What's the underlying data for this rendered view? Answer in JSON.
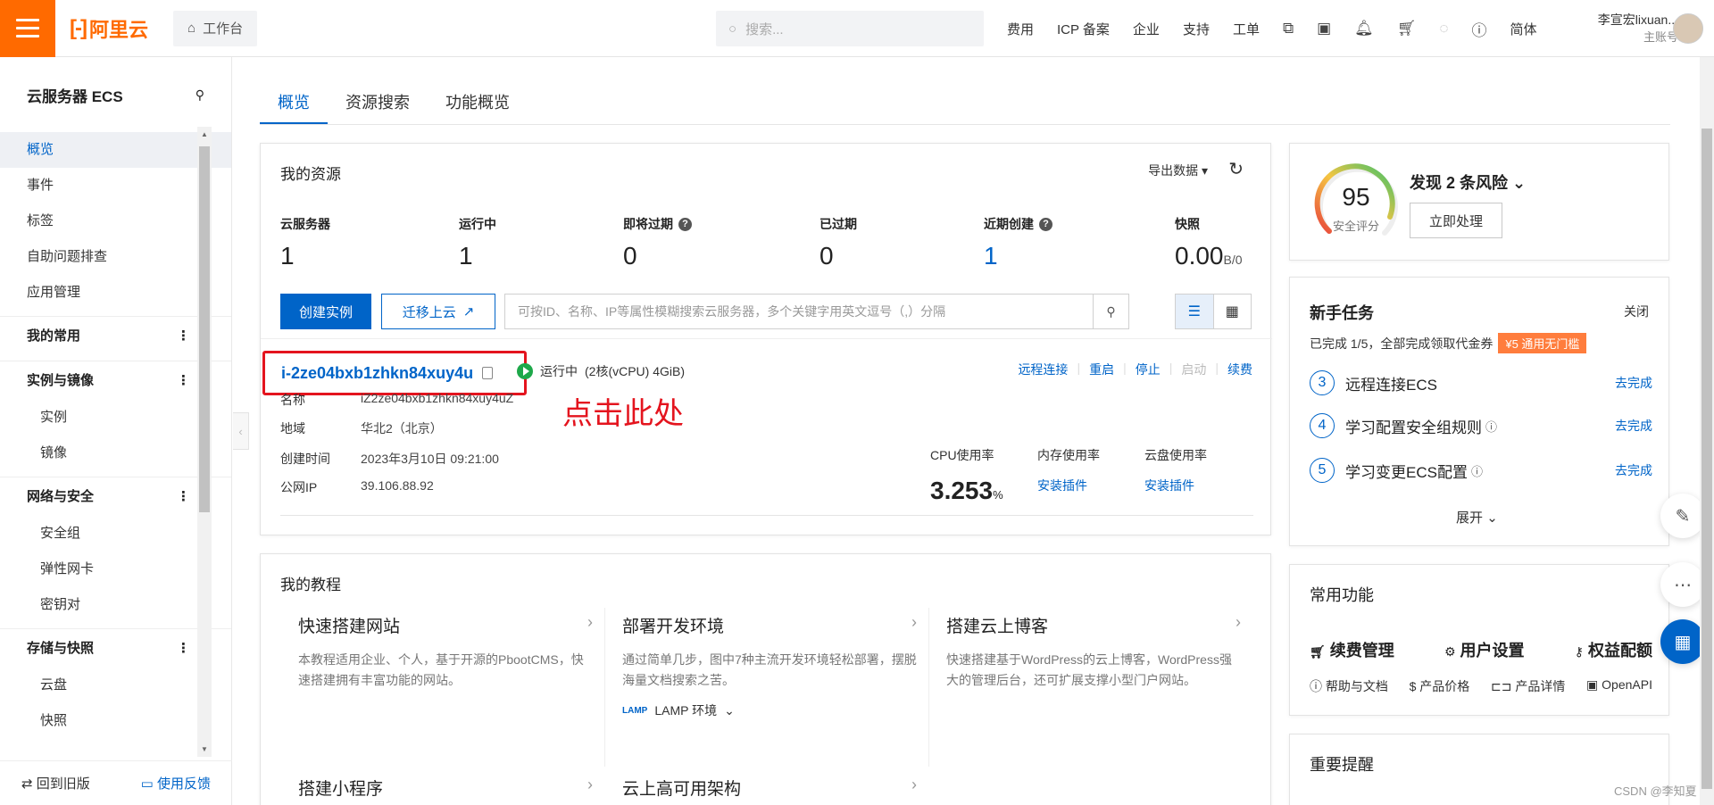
{
  "topbar": {
    "logo_text": "阿里云",
    "workbench": "工作台",
    "search_placeholder": "搜索...",
    "nav": [
      "费用",
      "ICP 备案",
      "企业",
      "支持",
      "工单"
    ],
    "lang": "简体",
    "account_name": "李宣宏lixuan...",
    "account_type": "主账号"
  },
  "sidebar": {
    "title": "云服务器 ECS",
    "items": [
      "概览",
      "事件",
      "标签",
      "自助问题排查",
      "应用管理"
    ],
    "groups": [
      {
        "name": "我的常用",
        "items": []
      },
      {
        "name": "实例与镜像",
        "items": [
          "实例",
          "镜像"
        ]
      },
      {
        "name": "网络与安全",
        "items": [
          "安全组",
          "弹性网卡",
          "密钥对"
        ]
      },
      {
        "name": "存储与快照",
        "items": [
          "云盘",
          "快照"
        ]
      }
    ],
    "footer_back": "回到旧版",
    "footer_feedback": "使用反馈"
  },
  "tabs": [
    "概览",
    "资源搜索",
    "功能概览"
  ],
  "resources": {
    "title": "我的资源",
    "export": "导出数据",
    "stats": [
      {
        "label": "云服务器",
        "value": "1"
      },
      {
        "label": "运行中",
        "value": "1"
      },
      {
        "label": "即将过期",
        "value": "0"
      },
      {
        "label": "已过期",
        "value": "0"
      },
      {
        "label": "近期创建",
        "value": "1"
      },
      {
        "label": "快照",
        "value": "0.00",
        "unit": "B/0"
      }
    ],
    "create_btn": "创建实例",
    "migrate_btn": "迁移上云",
    "search_placeholder": "可按ID、名称、IP等属性模糊搜索云服务器，多个关键字用英文逗号（,）分隔",
    "instance": {
      "id": "i-2ze04bxb1zhkn84xuy4u",
      "status": "运行中",
      "spec": "(2核(vCPU) 4GiB)",
      "annotation": "点击此处",
      "actions": [
        "远程连接",
        "重启",
        "停止",
        "启动",
        "续费"
      ],
      "fields": [
        {
          "k": "名称",
          "v": "iZ2ze04bxb1zhkn84xuy4uZ"
        },
        {
          "k": "地域",
          "v": "华北2（北京）"
        },
        {
          "k": "创建时间",
          "v": "2023年3月10日 09:21:00"
        },
        {
          "k": "公网IP",
          "v": "39.106.88.92"
        }
      ],
      "cpu_label": "CPU使用率",
      "cpu_value": "3.253",
      "cpu_unit": "%",
      "mem_label": "内存使用率",
      "disk_label": "云盘使用率",
      "install_plugin": "安装插件"
    }
  },
  "tutorials": {
    "title": "我的教程",
    "items": [
      {
        "title": "快速搭建网站",
        "desc": "本教程适用企业、个人，基于开源的PbootCMS，快速搭建拥有丰富功能的网站。"
      },
      {
        "title": "部署开发环境",
        "desc": "通过简单几步，图中7种主流开发环境轻松部署，摆脱海量文档搜索之苦。",
        "env": "LAMP 环境"
      },
      {
        "title": "搭建云上博客",
        "desc": "快速搭建基于WordPress的云上博客，WordPress强大的管理后台，还可扩展支撑小型门户网站。"
      },
      {
        "title": "搭建小程序"
      },
      {
        "title": "云上高可用架构"
      }
    ]
  },
  "security": {
    "score": "95",
    "score_label": "安全评分",
    "risk": "发现 2 条风险",
    "handle_btn": "立即处理"
  },
  "tasks": {
    "title": "新手任务",
    "close": "关闭",
    "progress": "已完成 1/5，全部完成领取代金券",
    "coupon": "¥5 通用无门槛",
    "items": [
      {
        "n": "3",
        "label": "远程连接ECS",
        "go": "去完成"
      },
      {
        "n": "4",
        "label": "学习配置安全组规则",
        "go": "去完成"
      },
      {
        "n": "5",
        "label": "学习变更ECS配置",
        "go": "去完成"
      }
    ],
    "expand": "展开"
  },
  "functions": {
    "title": "常用功能",
    "primary": [
      "续费管理",
      "用户设置",
      "权益配额"
    ],
    "secondary": [
      "帮助与文档",
      "产品价格",
      "产品详情",
      "OpenAPI"
    ]
  },
  "reminder": {
    "title": "重要提醒"
  },
  "watermark": "CSDN @李知夏",
  "colors": {
    "brand": "#ff6a00",
    "primary": "#0064c8",
    "annotation": "#e4141e",
    "running": "#1ea84a"
  }
}
